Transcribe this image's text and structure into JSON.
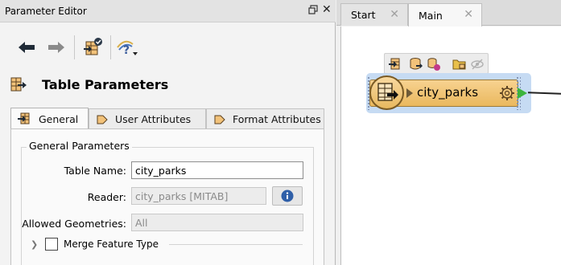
{
  "panel": {
    "title": "Parameter Editor",
    "section_title": "Table Parameters"
  },
  "toolbar": {
    "back_icon": "arrow-left-icon",
    "forward_icon": "arrow-right-icon",
    "apply_icon": "table-check-icon",
    "help_icon": "help-question-icon"
  },
  "tabs": [
    {
      "label": "General",
      "active": true
    },
    {
      "label": "User Attributes",
      "active": false
    },
    {
      "label": "Format Attributes",
      "active": false
    }
  ],
  "general": {
    "group_label": "General Parameters",
    "table_name_label": "Table Name:",
    "table_name_value": "city_parks",
    "reader_label": "Reader:",
    "reader_value": "city_parks [MITAB]",
    "allowed_geometries_label": "Allowed Geometries:",
    "allowed_geometries_value": "All",
    "merge_feature_type_label": "Merge Feature Type",
    "merge_feature_type_checked": false
  },
  "canvas_tabs": [
    {
      "label": "Start",
      "active": false
    },
    {
      "label": "Main",
      "active": true
    }
  ],
  "node": {
    "label": "city_parks"
  },
  "colors": {
    "node_fill": "#eab85e",
    "node_halo": "#c6dbf3",
    "output_port": "#3cb43c",
    "info_blue": "#2f5fa8"
  }
}
